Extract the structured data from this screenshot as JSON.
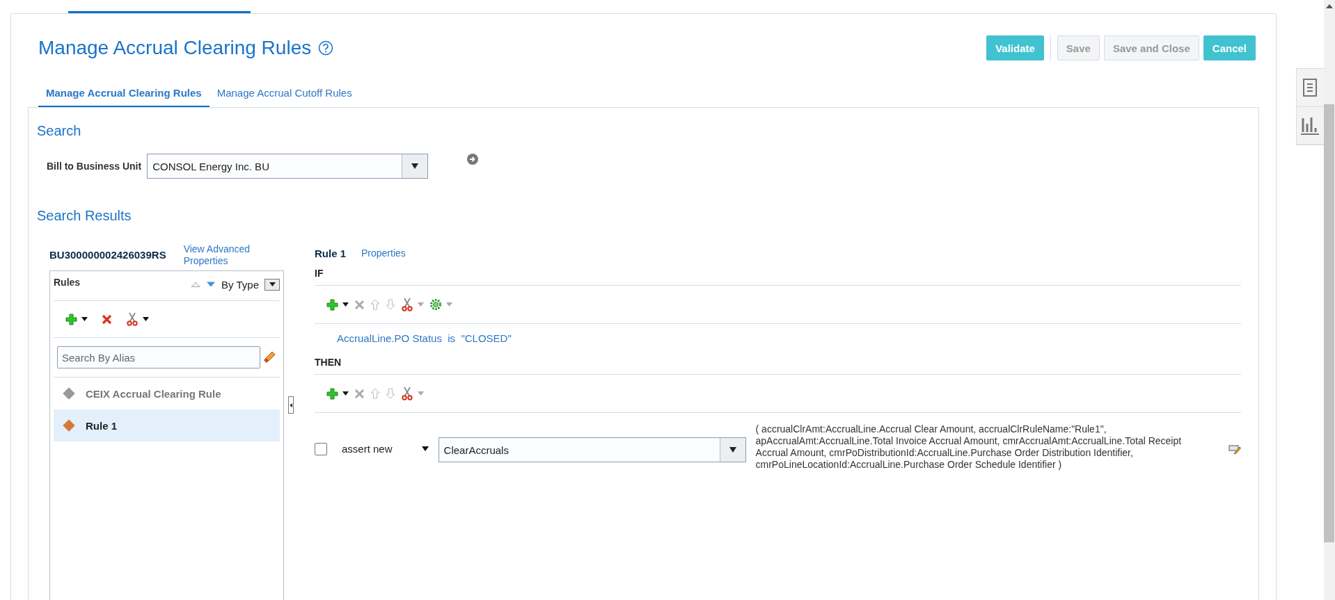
{
  "header": {
    "title": "Manage Accrual Clearing Rules",
    "buttons": [
      {
        "label": "Validate",
        "kind": "primary",
        "disabled": false
      },
      {
        "label": "Save",
        "kind": "secondary",
        "disabled": true
      },
      {
        "label": "Save and Close",
        "kind": "secondary",
        "disabled": true
      },
      {
        "label": "Cancel",
        "kind": "primary",
        "disabled": false
      }
    ]
  },
  "tabs": [
    {
      "label": "Manage Accrual Clearing Rules",
      "selected": true
    },
    {
      "label": "Manage Accrual Cutoff Rules",
      "selected": false
    }
  ],
  "search": {
    "heading": "Search",
    "field_label": "Bill to Business Unit",
    "value": "CONSOL Energy Inc. BU"
  },
  "results": {
    "heading": "Search Results",
    "ruleset": "BU300000002426039RS",
    "advanced_link": "View Advanced Properties",
    "rules_panel": {
      "title": "Rules",
      "sort": "By Type",
      "search_placeholder": "Search By Alias",
      "items": [
        {
          "label": "CEIX Accrual Clearing Rule",
          "selected": false
        },
        {
          "label": "Rule 1",
          "selected": true
        }
      ]
    }
  },
  "rule": {
    "name": "Rule 1",
    "properties_link": "Properties",
    "if_label": "IF",
    "condition": "AccrualLine.PO Status  is  \"CLOSED\"",
    "then_label": "THEN",
    "action": {
      "checked": false,
      "verb": "assert new",
      "fact": "ClearAccruals",
      "arguments": "( accrualClrAmt:AccrualLine.Accrual Clear Amount, accrualClrRuleName:\"Rule1\", apAccrualAmt:AccrualLine.Total Invoice Accrual Amount, cmrAccrualAmt:AccrualLine.Total Receipt Accrual Amount, cmrPoDistributionId:AccrualLine.Purchase Order Distribution Identifier, cmrPoLineLocationId:AccrualLine.Purchase Order Schedule Identifier )"
    }
  }
}
